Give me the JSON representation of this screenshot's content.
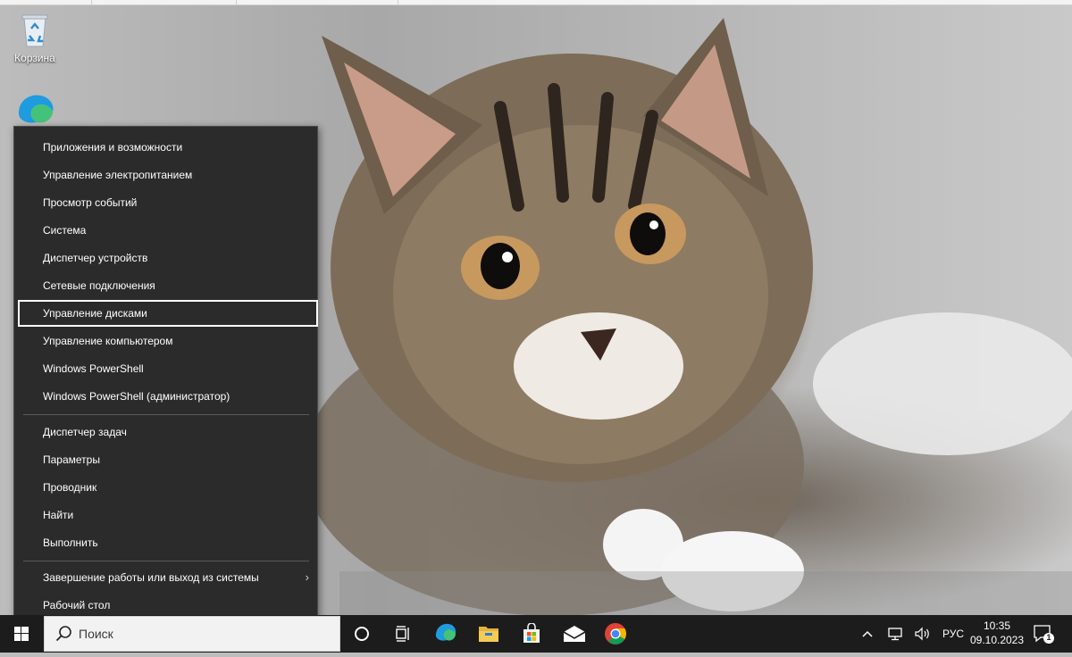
{
  "desktop": {
    "icons": [
      {
        "label": "Корзина",
        "icon": "recycle-bin-icon"
      },
      {
        "label": "",
        "icon": "edge-icon"
      }
    ]
  },
  "context_menu": {
    "group1": [
      "Приложения и возможности",
      "Управление электропитанием",
      "Просмотр событий",
      "Система",
      "Диспетчер устройств",
      "Сетевые подключения",
      "Управление дисками",
      "Управление компьютером",
      "Windows PowerShell",
      "Windows PowerShell (администратор)"
    ],
    "group2": [
      "Диспетчер задач",
      "Параметры",
      "Проводник",
      "Найти",
      "Выполнить"
    ],
    "group3": [
      "Завершение работы или выход из системы",
      "Рабочий стол"
    ],
    "selected": "Управление дисками",
    "submenu_arrow": "›"
  },
  "taskbar": {
    "search_placeholder": "Поиск",
    "pinned": [
      "cortana-icon",
      "task-view-icon",
      "edge-icon",
      "file-explorer-icon",
      "store-icon",
      "mail-icon",
      "chrome-icon"
    ],
    "tray": {
      "language": "РУС",
      "time": "10:35",
      "date": "09.10.2023",
      "notifications_count": "1"
    }
  },
  "colors": {
    "menu_bg": "#2b2b2b",
    "taskbar_bg": "#1c1c1c",
    "selection_outline": "#ffffff"
  }
}
